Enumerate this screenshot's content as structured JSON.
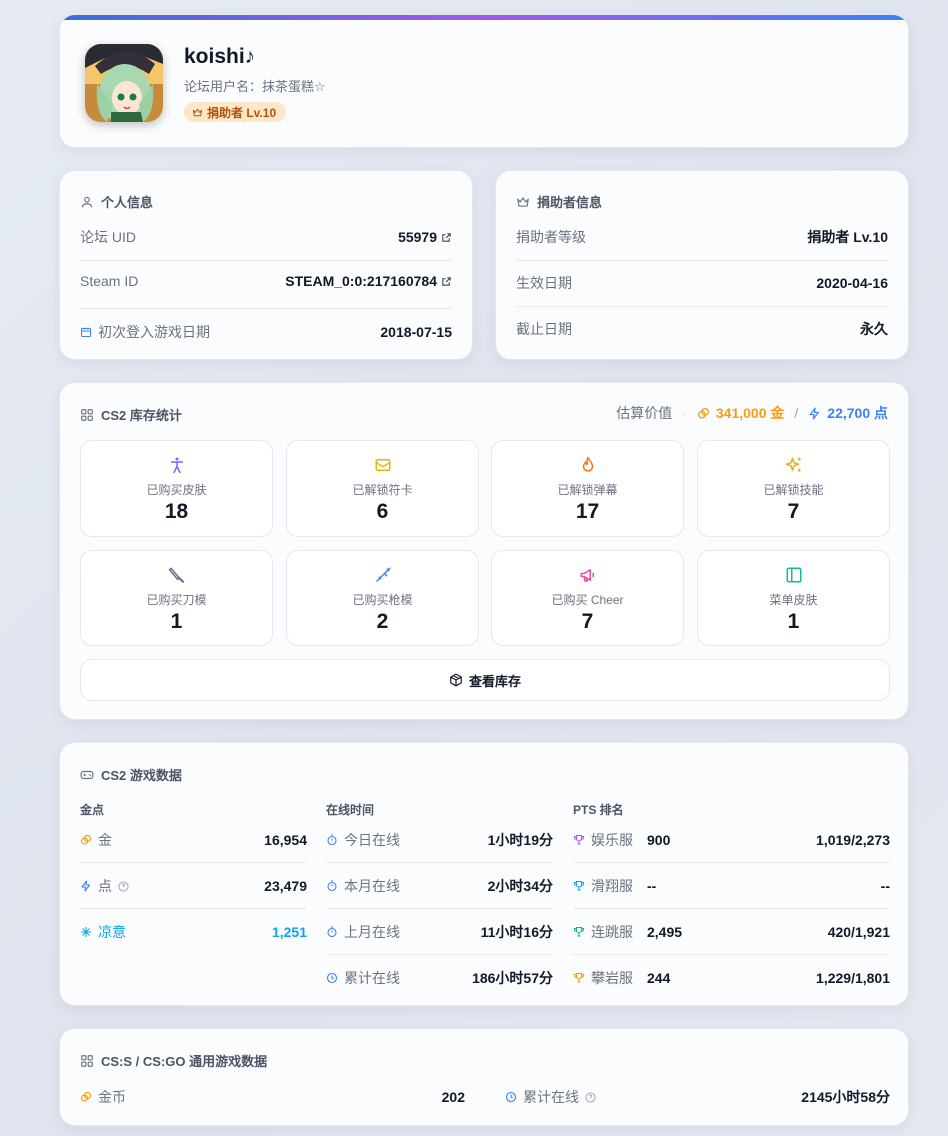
{
  "profile": {
    "display_name": "koishi♪",
    "forum_username": "论坛用户名：抹茶蛋糕☆",
    "badge": "捐助者 Lv.10"
  },
  "personal": {
    "title": "个人信息",
    "uid_label": "论坛 UID",
    "uid_value": "55979",
    "steam_label": "Steam ID",
    "steam_value": "STEAM_0:0:217160784",
    "first_login_label": "初次登入游戏日期",
    "first_login_value": "2018-07-15"
  },
  "donor": {
    "title": "捐助者信息",
    "level_label": "捐助者等级",
    "level_value": "捐助者 Lv.10",
    "start_label": "生效日期",
    "start_value": "2020-04-16",
    "end_label": "截止日期",
    "end_value": "永久"
  },
  "inventory": {
    "title": "CS2 库存统计",
    "estimate_label": "估算价值",
    "gold_value": "341,000 金",
    "slash": "/",
    "points_value": "22,700 点",
    "stats": [
      {
        "label": "已购买皮肤",
        "value": "18",
        "icon": "person-icon",
        "color": "#8b5cf6"
      },
      {
        "label": "已解锁符卡",
        "value": "6",
        "icon": "card-icon",
        "color": "#eab308"
      },
      {
        "label": "已解锁弹幕",
        "value": "17",
        "icon": "flame-icon",
        "color": "#f97316"
      },
      {
        "label": "已解锁技能",
        "value": "7",
        "icon": "sparkles-icon",
        "color": "#eab308"
      },
      {
        "label": "已购买刀模",
        "value": "1",
        "icon": "knife-icon",
        "color": "#64748b"
      },
      {
        "label": "已购买枪模",
        "value": "2",
        "icon": "rifle-icon",
        "color": "#3b82f6"
      },
      {
        "label": "已购买 Cheer",
        "value": "7",
        "icon": "megaphone-icon",
        "color": "#ec4899"
      },
      {
        "label": "菜单皮肤",
        "value": "1",
        "icon": "panel-icon",
        "color": "#14b8a6"
      }
    ],
    "view_button": "查看库存"
  },
  "game": {
    "title": "CS2 游戏数据",
    "col_gold": "金点",
    "col_online": "在线时间",
    "col_pts": "PTS 排名",
    "gold_label": "金",
    "gold_value": "16,954",
    "point_label": "点",
    "point_value": "23,479",
    "cool_label": "凉意",
    "cool_value": "1,251",
    "today_label": "今日在线",
    "today_value": "1小时19分",
    "month_label": "本月在线",
    "month_value": "2小时34分",
    "lastmonth_label": "上月在线",
    "lastmonth_value": "11小时16分",
    "total_label": "累计在线",
    "total_value": "186小时57分",
    "pts": [
      {
        "server": "娱乐服",
        "score": "900",
        "rank": "1,019/2,273",
        "color": "#a855f7"
      },
      {
        "server": "滑翔服",
        "score": "--",
        "rank": "--",
        "color": "#0ea5e9"
      },
      {
        "server": "连跳服",
        "score": "2,495",
        "rank": "420/1,921",
        "color": "#10b981"
      },
      {
        "server": "攀岩服",
        "score": "244",
        "rank": "1,229/1,801",
        "color": "#f59e0b"
      }
    ]
  },
  "csgo": {
    "title": "CS:S / CS:GO 通用游戏数据",
    "coin_label": "金币",
    "coin_value": "202",
    "online_label": "累计在线",
    "online_value": "2145小时58分"
  },
  "colors": {
    "accent_gold": "#f59e0b",
    "accent_blue": "#3b82f6",
    "cool_cyan": "#0ea5e9"
  }
}
